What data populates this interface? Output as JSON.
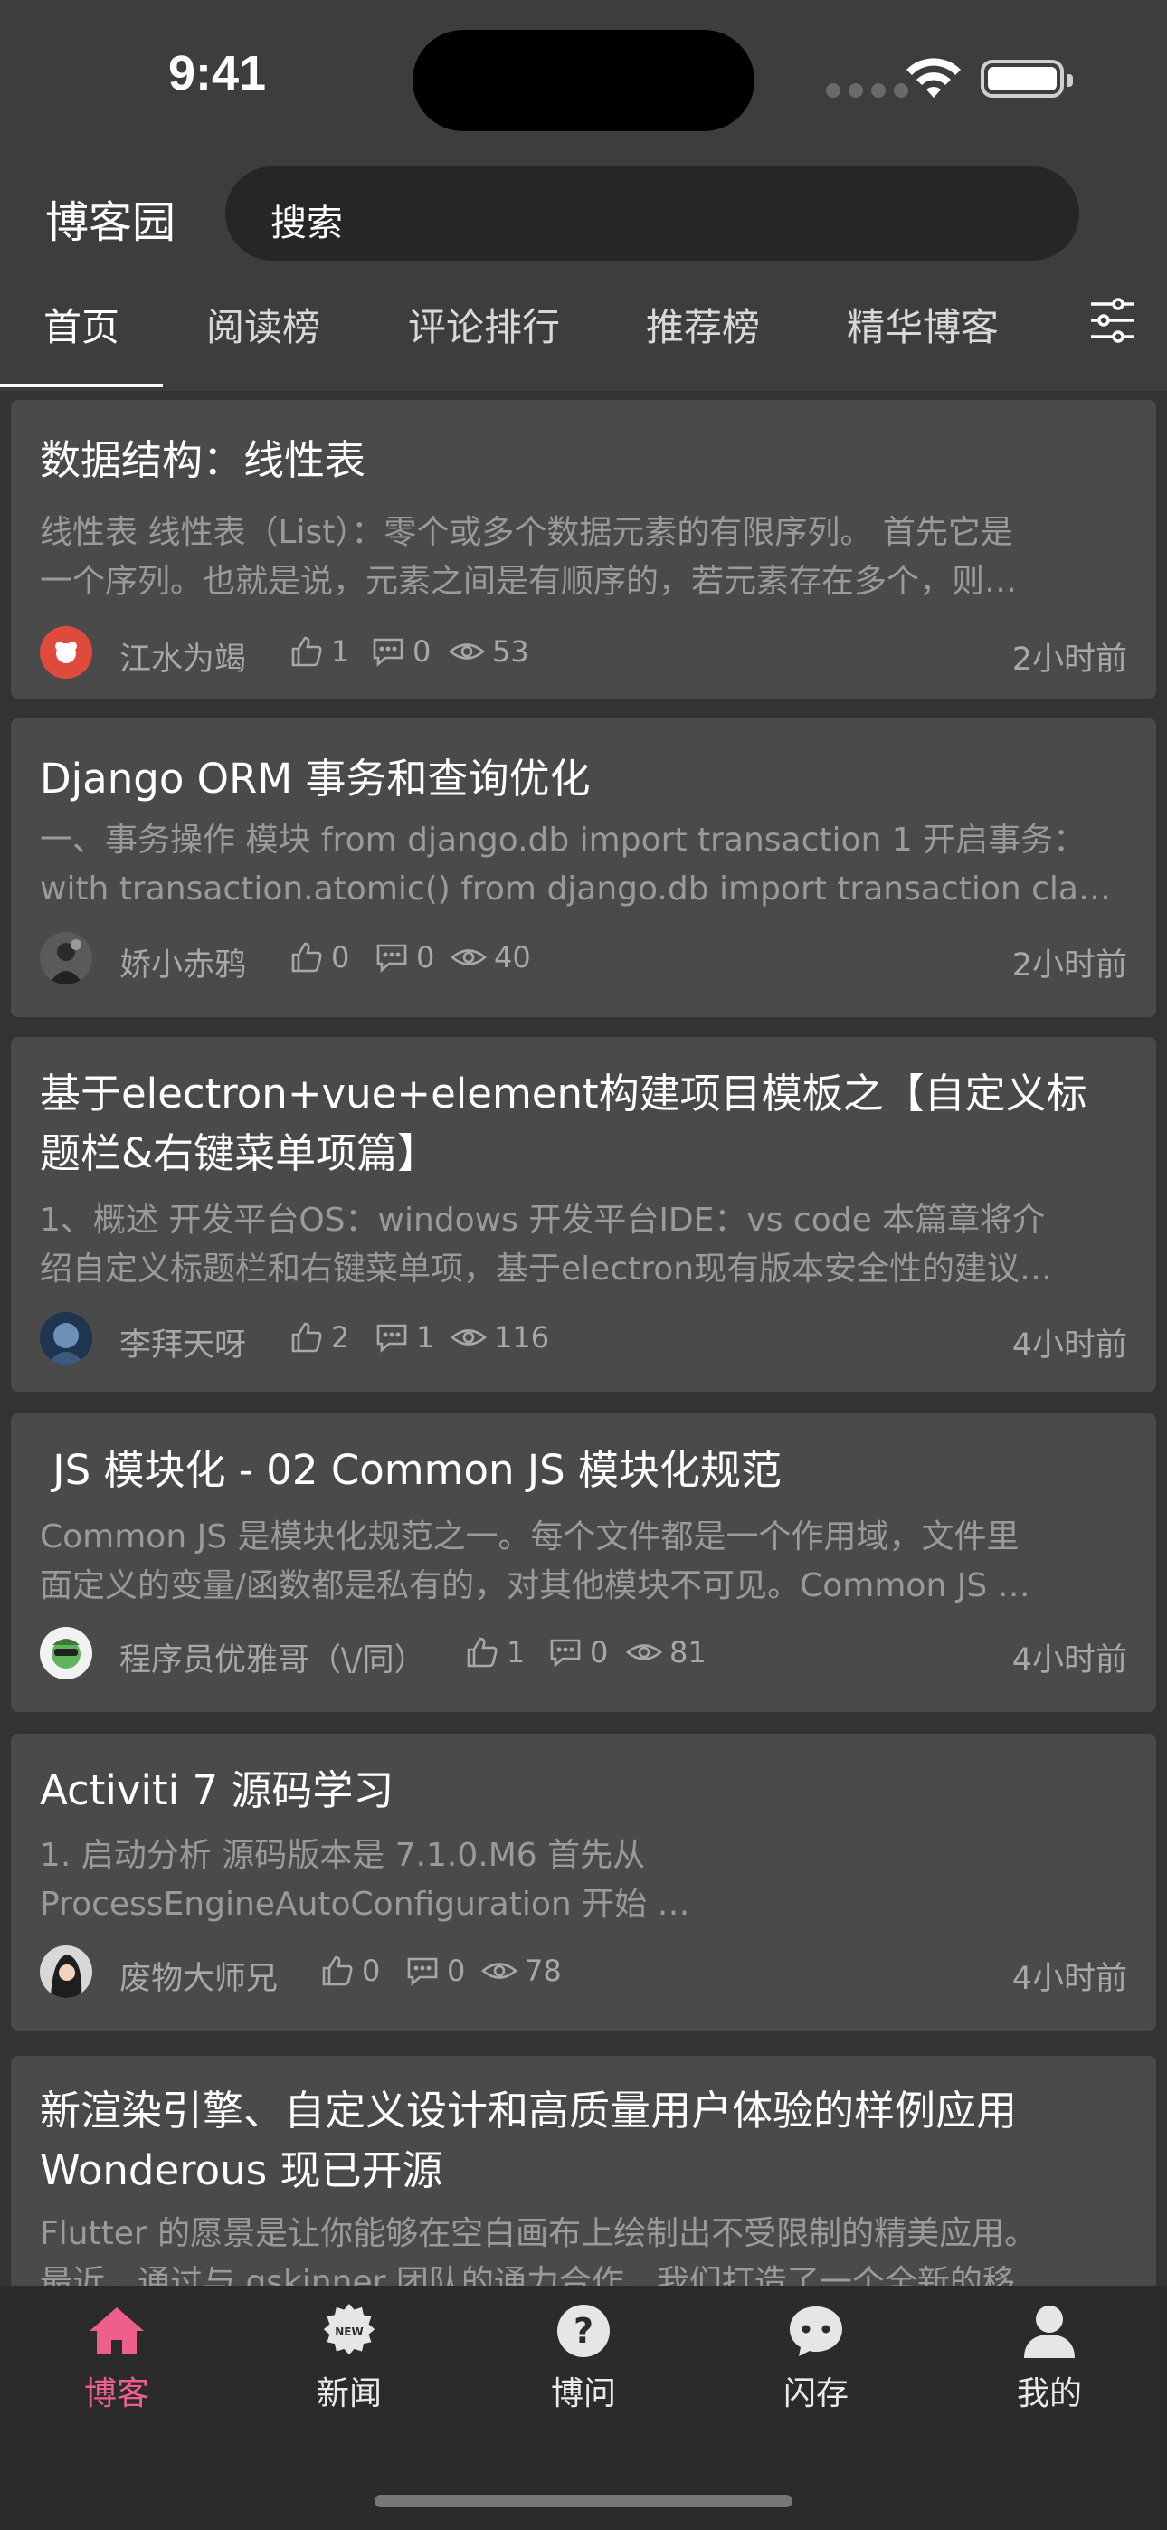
{
  "status_bar": {
    "time": "9:41"
  },
  "header": {
    "app_title": "博客园",
    "search_placeholder": "搜索"
  },
  "tabs": [
    {
      "label": "首页",
      "active": true
    },
    {
      "label": "阅读榜"
    },
    {
      "label": "评论排行"
    },
    {
      "label": "推荐榜"
    },
    {
      "label": "精华博客"
    }
  ],
  "posts": [
    {
      "title": "数据结构：线性表",
      "summary": "线性表 线性表（List）：零个或多个数据元素的有限序列。 首先它是\n一个序列。也就是说，元素之间是有顺序的，若元素存在多个，则…",
      "author": "江水为竭",
      "likes": "1",
      "comments": "0",
      "views": "53",
      "time": "2小时前"
    },
    {
      "title": "Django ORM 事务和查询优化",
      "summary": "一、事务操作 模块 from django.db import transaction 1 开启事务：\nwith transaction.atomic() from django.db import transaction cla…",
      "author": "娇小赤鸦",
      "likes": "0",
      "comments": "0",
      "views": "40",
      "time": "2小时前"
    },
    {
      "title": "基于electron+vue+element构建项目模板之【自定义标\n题栏&右键菜单项篇】",
      "summary": "1、概述 开发平台OS：windows 开发平台IDE：vs code 本篇章将介\n绍自定义标题栏和右键菜单项，基于electron现有版本安全性的建议…",
      "author": "李拜天呀",
      "likes": "2",
      "comments": "1",
      "views": "116",
      "time": "4小时前"
    },
    {
      "title": " JS 模块化 - 02 Common JS 模块化规范",
      "summary": "Common JS 是模块化规范之一。每个文件都是一个作用域，文件里\n面定义的变量/函数都是私有的，对其他模块不可见。Common JS …",
      "author": "程序员优雅哥（\\/同）",
      "likes": "1",
      "comments": "0",
      "views": "81",
      "time": "4小时前"
    },
    {
      "title": "Activiti 7 源码学习",
      "summary": "1. 启动分析 源码版本是 7.1.0.M6 首先从\nProcessEngineAutoConfiguration 开始 …",
      "author": "废物大师兄",
      "likes": "0",
      "comments": "0",
      "views": "78",
      "time": "4小时前"
    },
    {
      "title": "新渲染引擎、自定义设计和高质量用户体验的样例应用\nWonderous 现已开源",
      "summary": "Flutter 的愿景是让你能够在空白画布上绘制出不受限制的精美应用。\n最近，通过与 gskinner 团队的通力合作，我们打造了一个全新的移…",
      "author": "",
      "likes": "",
      "comments": "",
      "views": "",
      "time": ""
    }
  ],
  "bottom_nav": [
    {
      "label": "博客",
      "icon": "home-icon",
      "active": true
    },
    {
      "label": "新闻",
      "icon": "news-icon"
    },
    {
      "label": "博问",
      "icon": "question-icon"
    },
    {
      "label": "闪存",
      "icon": "chat-icon"
    },
    {
      "label": "我的",
      "icon": "profile-icon"
    }
  ],
  "colors": {
    "accent": "#ee5f8c",
    "background": "#3d3d3d",
    "card": "#4a4a4a",
    "nav_bg": "#2b2b2b"
  }
}
